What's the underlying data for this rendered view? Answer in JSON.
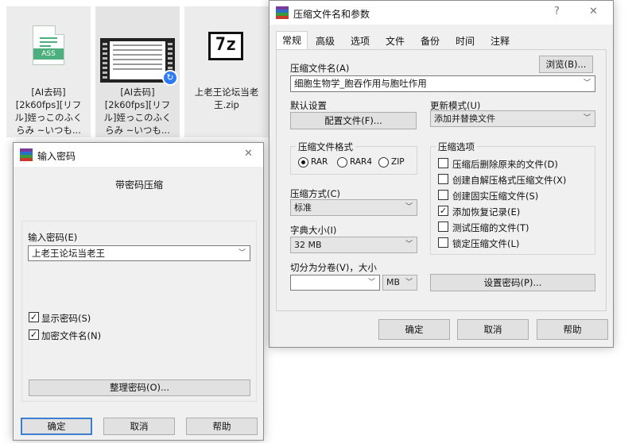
{
  "files": [
    {
      "label": "[AI去码][2k60fps][リフル]姪っこのふくらみ ~いつも...",
      "lines": [
        "[AI去码]",
        "[2k60fps][リフ",
        "ル]姪っこのふく",
        "らみ ~いつも..."
      ],
      "icon": "ass-file-icon",
      "icon_text": "ASS"
    },
    {
      "label": "[AI去码][2k60fps][リフル]姪っこのふくらみ ~いつも...",
      "lines": [
        "[AI去码]",
        "[2k60fps][リフ",
        "ル]姪っこのふく",
        "らみ ~いつも..."
      ],
      "icon": "video-file-icon"
    },
    {
      "label": "上老王论坛当老王.zip",
      "lines": [
        "上老王论坛当老",
        "王.zip"
      ],
      "icon": "7z-archive-icon",
      "icon_text": "7z"
    }
  ],
  "archive_dialog": {
    "title": "压缩文件名和参数",
    "help_glyph": "?",
    "close_glyph": "✕",
    "tabs": [
      "常规",
      "高级",
      "选项",
      "文件",
      "备份",
      "时间",
      "注释"
    ],
    "active_tab": "常规",
    "archive_name_label": "压缩文件名(A)",
    "browse_button": "浏览(B)...",
    "archive_name_value": "细胞生物学_胞吞作用与胞吐作用",
    "default_settings_label": "默认设置",
    "profiles_button": "配置文件(F)...",
    "update_mode_label": "更新模式(U)",
    "update_mode_value": "添加并替换文件",
    "format_group": "压缩文件格式",
    "formats": [
      "RAR",
      "RAR4",
      "ZIP"
    ],
    "selected_format": "RAR",
    "method_label": "压缩方式(C)",
    "method_value": "标准",
    "dict_label": "字典大小(I)",
    "dict_value": "32 MB",
    "split_label": "切分为分卷(V)，大小",
    "split_value": "",
    "split_unit": "MB",
    "options_group": "压缩选项",
    "options": [
      {
        "label": "压缩后删除原来的文件(D)",
        "checked": false
      },
      {
        "label": "创建自解压格式压缩文件(X)",
        "checked": false
      },
      {
        "label": "创建固实压缩文件(S)",
        "checked": false
      },
      {
        "label": "添加恢复记录(E)",
        "checked": true
      },
      {
        "label": "测试压缩的文件(T)",
        "checked": false
      },
      {
        "label": "锁定压缩文件(L)",
        "checked": false
      }
    ],
    "set_password_button": "设置密码(P)...",
    "ok_button": "确定",
    "cancel_button": "取消",
    "help_button": "帮助"
  },
  "password_dialog": {
    "title": "输入密码",
    "close_glyph": "✕",
    "heading": "带密码压缩",
    "password_label": "输入密码(E)",
    "password_value": "上老王论坛当老王",
    "show_password": {
      "label": "显示密码(S)",
      "checked": true
    },
    "encrypt_names": {
      "label": "加密文件名(N)",
      "checked": true
    },
    "organize_button": "整理密码(O)...",
    "ok_button": "确定",
    "cancel_button": "取消",
    "help_button": "帮助"
  },
  "colors": {
    "accent": "#3c7fd1",
    "dialog_bg": "#f0f0f0"
  }
}
